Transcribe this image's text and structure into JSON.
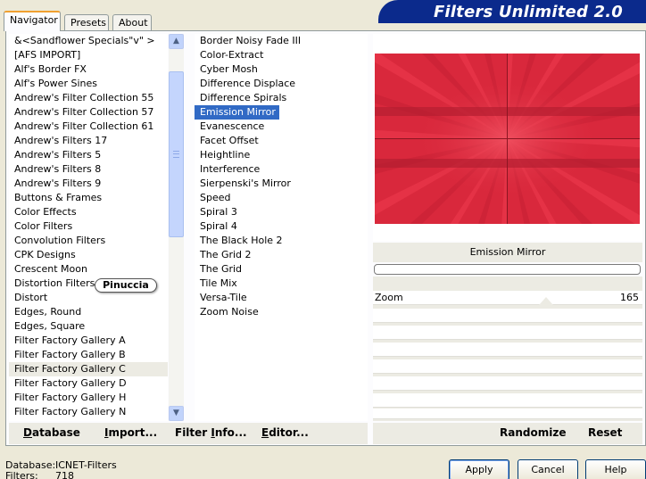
{
  "tabs": [
    {
      "label": "Navigator",
      "active": true
    },
    {
      "label": "Presets",
      "active": false
    },
    {
      "label": "About",
      "active": false
    }
  ],
  "banner": {
    "title": "Filters Unlimited 2.0",
    "color": "#0b2a8c"
  },
  "categories": [
    "&<Sandflower Specials\"v\" >",
    "[AFS IMPORT]",
    "Alf's Border FX",
    "Alf's Power Sines",
    "Andrew's Filter Collection 55",
    "Andrew's Filter Collection 57",
    "Andrew's Filter Collection 61",
    "Andrew's Filters 17",
    "Andrew's Filters 5",
    "Andrew's Filters 8",
    "Andrew's Filters 9",
    "Buttons & Frames",
    "Color Effects",
    "Color Filters",
    "Convolution Filters",
    "CPK Designs",
    "Crescent Moon",
    "Distortion Filters",
    "Distort",
    "Edges, Round",
    "Edges, Square",
    "Filter Factory Gallery A",
    "Filter Factory Gallery B",
    "Filter Factory Gallery C",
    "Filter Factory Gallery D",
    "Filter Factory Gallery H",
    "Filter Factory Gallery N"
  ],
  "selected_category": "Filter Factory Gallery C",
  "watermark": "Pinuccia",
  "filters": [
    "Border Noisy Fade III",
    "Color-Extract",
    "Cyber Mosh",
    "Difference Displace",
    "Difference Spirals",
    "Emission Mirror",
    "Evanescence",
    "Facet Offset",
    "Heightline",
    "Interference",
    "Sierpenski's Mirror",
    "Speed",
    "Spiral 3",
    "Spiral 4",
    "The Black Hole 2",
    "The Grid 2",
    "The Grid",
    "Tile Mix",
    "Versa-Tile",
    "Zoom Noise"
  ],
  "selected_filter": "Emission Mirror",
  "preview": {
    "filter_name": "Emission Mirror",
    "base_color": "#d9283c"
  },
  "params": [
    {
      "label": "Zoom",
      "value": "165"
    }
  ],
  "left_buttons": {
    "database": {
      "ul": "D",
      "rest": "atabase"
    },
    "import": {
      "ul": "I",
      "rest": "mport..."
    },
    "filter_info": {
      "pre": "Filter ",
      "ul": "I",
      "rest": "nfo..."
    },
    "editor": {
      "ul": "E",
      "rest": "ditor..."
    }
  },
  "right_buttons": {
    "randomize": "Randomize",
    "reset": "Reset"
  },
  "status": {
    "database_label": "Database:",
    "database_value": "ICNET-Filters",
    "filters_label": "Filters:",
    "filters_value": "718"
  },
  "dialog": {
    "apply": "Apply",
    "cancel": "Cancel",
    "help": "Help"
  }
}
